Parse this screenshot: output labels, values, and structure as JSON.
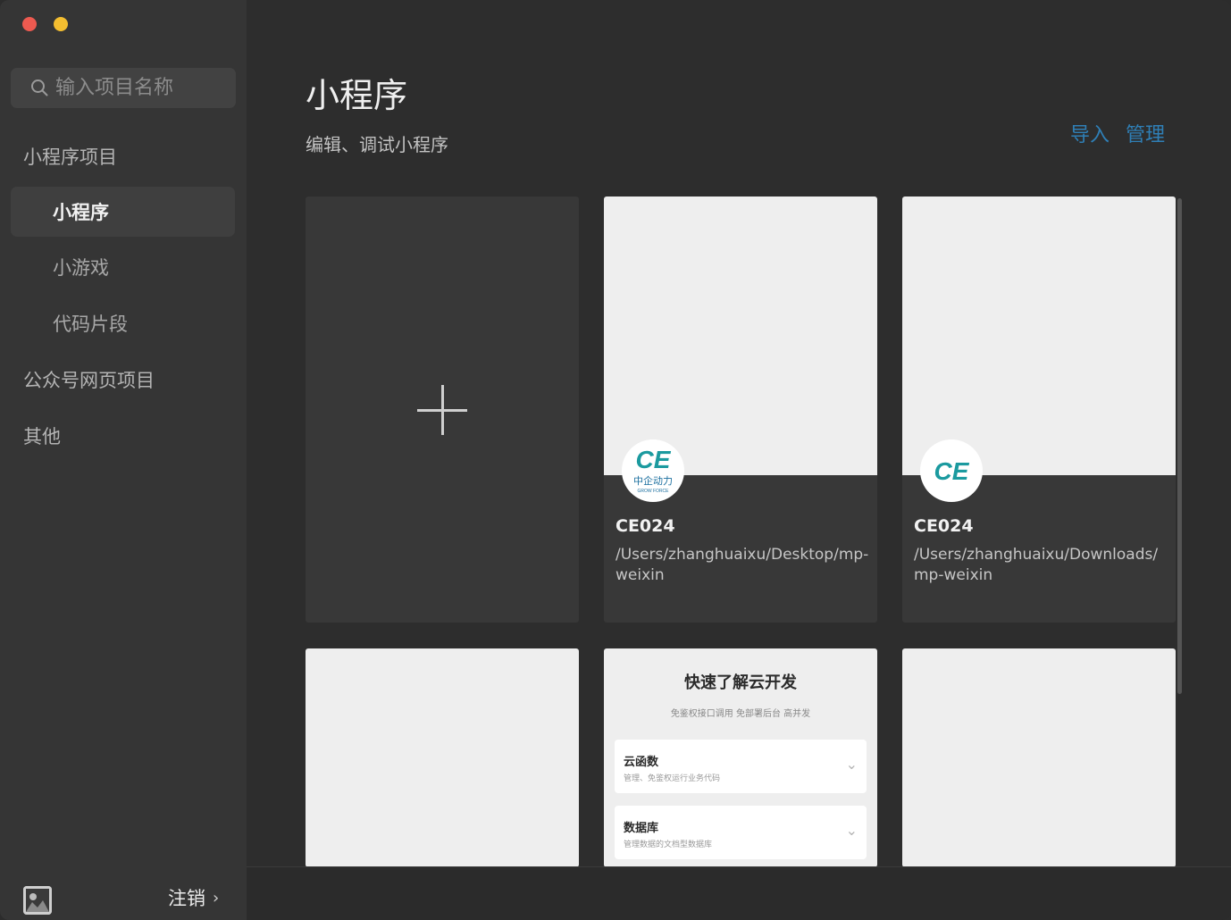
{
  "search": {
    "placeholder": "输入项目名称"
  },
  "sidebar": {
    "sections": [
      {
        "label": "小程序项目"
      },
      {
        "label": "公众号网页项目"
      },
      {
        "label": "其他"
      }
    ],
    "sub_items": [
      {
        "label": "小程序",
        "active": true
      },
      {
        "label": "小游戏",
        "active": false
      },
      {
        "label": "代码片段",
        "active": false
      }
    ],
    "logout_label": "注销",
    "logout_chevron": "›"
  },
  "main": {
    "title": "小程序",
    "subtitle": "编辑、调试小程序",
    "actions": {
      "import": "导入",
      "manage": "管理"
    }
  },
  "projects": [
    {
      "name": "CE024",
      "path": "/Users/zhanghuaixu/Desktop/mp-weixin",
      "logo_text": "CE",
      "logo_caption": "中企动力",
      "logo_caption2": "GROW FORCE"
    },
    {
      "name": "CE024",
      "path": "/Users/zhanghuaixu/Downloads/mp-weixin",
      "logo_text": "CE"
    }
  ],
  "cloud_preview": {
    "title": "快速了解云开发",
    "subtitle": "免鉴权接口调用 免部署后台 高并发",
    "items": [
      {
        "title": "云函数",
        "desc": "管理、免鉴权运行业务代码"
      },
      {
        "title": "数据库",
        "desc": "管理数据的文档型数据库"
      }
    ]
  },
  "colors": {
    "accent": "#2f7fb6",
    "logo_teal": "#1b9a9f",
    "traffic_red": "#ed5a50",
    "traffic_yellow": "#f4be30"
  }
}
